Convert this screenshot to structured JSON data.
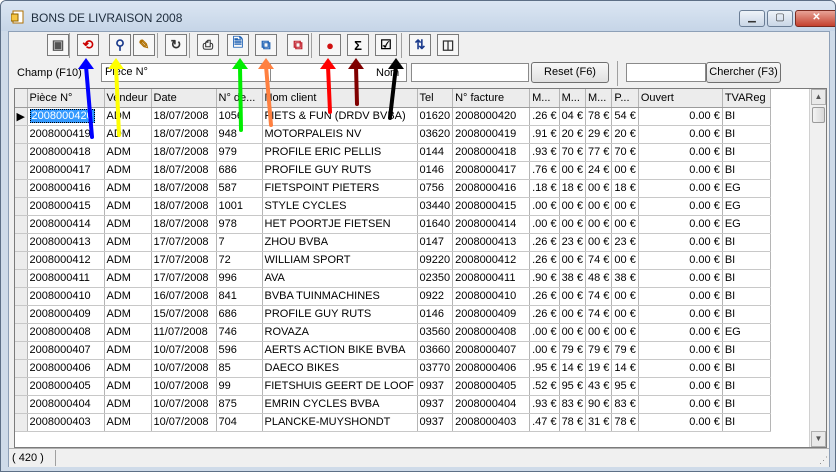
{
  "window": {
    "title": "BONS DE LIVRAISON 2008",
    "minimize_icon": "minimize-icon",
    "maximize_icon": "maximize-icon",
    "close_icon": "close-icon"
  },
  "toolbar": {
    "buttons": [
      {
        "name": "properties-button",
        "icon": "properties-icon",
        "glyph": "▣",
        "color": "#555555"
      },
      {
        "name": "stop-button",
        "icon": "stop-icon",
        "glyph": "⟲",
        "color": "#cc0000"
      },
      {
        "name": "find-button",
        "icon": "binoculars-icon",
        "glyph": "⚲",
        "color": "#1a3a8c"
      },
      {
        "name": "filter-button",
        "icon": "pencil-filter-icon",
        "glyph": "✎",
        "color": "#b07000"
      },
      {
        "name": "refresh-button",
        "icon": "refresh-icon",
        "glyph": "↻",
        "color": "#333333"
      },
      {
        "name": "print-button",
        "icon": "printer-icon",
        "glyph": "⎙",
        "color": "#333333"
      },
      {
        "name": "new-document-button",
        "icon": "document-edit-icon",
        "glyph": "🗎",
        "color": "#1a5fb4"
      },
      {
        "name": "copy-document-button",
        "icon": "documents-copy-icon",
        "glyph": "⧉",
        "color": "#1a5fb4"
      },
      {
        "name": "delete-document-button",
        "icon": "document-delete-icon",
        "glyph": "⧉",
        "color": "#c01c28"
      },
      {
        "name": "info-button",
        "icon": "info-icon",
        "glyph": "●",
        "color": "#d01010"
      },
      {
        "name": "sum-button",
        "icon": "sigma-icon",
        "glyph": "Σ",
        "color": "#000000"
      },
      {
        "name": "validate-button",
        "icon": "checkbox-icon",
        "glyph": "☑",
        "color": "#000000"
      },
      {
        "name": "sort-button",
        "icon": "sort-az-icon",
        "glyph": "⇅",
        "color": "#1a3a8c"
      },
      {
        "name": "columns-button",
        "icon": "columns-icon",
        "glyph": "◫",
        "color": "#333333"
      }
    ]
  },
  "search": {
    "field_label": "Champ (F10)",
    "field_value": "Pièce N°",
    "nom_label": "Nom",
    "nom_value": "",
    "reset_label": "Reset (F6)",
    "search_value": "",
    "search_label": "Chercher (F3)"
  },
  "table": {
    "columns": [
      "Pièce N°",
      "Vendeur",
      "Date",
      "N° de...",
      "Nom client",
      "Tel",
      "N° facture",
      "M...",
      "M...",
      "M...",
      "P...",
      "Ouvert",
      "TVAReg"
    ],
    "rows": [
      [
        "2008000420",
        "ADM",
        "18/07/2008",
        "1056",
        "FIETS & FUN (DRDV BVBA)",
        "01620",
        "2008000420",
        ".26 €",
        "04 €",
        "78 €",
        "54 €",
        "0.00 €",
        "BI"
      ],
      [
        "2008000419",
        "ADM",
        "18/07/2008",
        "948",
        "MOTORPALEIS NV",
        "03620",
        "2008000419",
        ".91 €",
        "20 €",
        "29 €",
        "20 €",
        "0.00 €",
        "BI"
      ],
      [
        "2008000418",
        "ADM",
        "18/07/2008",
        "979",
        "PROFILE ERIC PELLIS",
        "0144",
        "2008000418",
        ".93 €",
        "70 €",
        "77 €",
        "70 €",
        "0.00 €",
        "BI"
      ],
      [
        "2008000417",
        "ADM",
        "18/07/2008",
        "686",
        "PROFILE GUY RUTS",
        "0146",
        "2008000417",
        ".76 €",
        "00 €",
        "24 €",
        "00 €",
        "0.00 €",
        "BI"
      ],
      [
        "2008000416",
        "ADM",
        "18/07/2008",
        "587",
        "FIETSPOINT PIETERS",
        "0756",
        "2008000416",
        ".18 €",
        "18 €",
        "00 €",
        "18 €",
        "0.00 €",
        "EG"
      ],
      [
        "2008000415",
        "ADM",
        "18/07/2008",
        "1001",
        "STYLE CYCLES",
        "03440",
        "2008000415",
        ".00 €",
        "00 €",
        "00 €",
        "00 €",
        "0.00 €",
        "EG"
      ],
      [
        "2008000414",
        "ADM",
        "18/07/2008",
        "978",
        "HET POORTJE FIETSEN",
        "01640",
        "2008000414",
        ".00 €",
        "00 €",
        "00 €",
        "00 €",
        "0.00 €",
        "EG"
      ],
      [
        "2008000413",
        "ADM",
        "17/07/2008",
        "7",
        "ZHOU BVBA",
        "0147",
        "2008000413",
        ".26 €",
        "23 €",
        "00 €",
        "23 €",
        "0.00 €",
        "BI"
      ],
      [
        "2008000412",
        "ADM",
        "17/07/2008",
        "72",
        "WILLIAM SPORT",
        "09220",
        "2008000412",
        ".26 €",
        "00 €",
        "74 €",
        "00 €",
        "0.00 €",
        "BI"
      ],
      [
        "2008000411",
        "ADM",
        "17/07/2008",
        "996",
        "AVA",
        "02350",
        "2008000411",
        ".90 €",
        "38 €",
        "48 €",
        "38 €",
        "0.00 €",
        "BI"
      ],
      [
        "2008000410",
        "ADM",
        "16/07/2008",
        "841",
        "BVBA TUINMACHINES",
        "0922",
        "2008000410",
        ".26 €",
        "00 €",
        "74 €",
        "00 €",
        "0.00 €",
        "BI"
      ],
      [
        "2008000409",
        "ADM",
        "15/07/2008",
        "686",
        "PROFILE GUY RUTS",
        "0146",
        "2008000409",
        ".26 €",
        "00 €",
        "74 €",
        "00 €",
        "0.00 €",
        "BI"
      ],
      [
        "2008000408",
        "ADM",
        "11/07/2008",
        "746",
        "ROVAZA",
        "03560",
        "2008000408",
        ".00 €",
        "00 €",
        "00 €",
        "00 €",
        "0.00 €",
        "EG"
      ],
      [
        "2008000407",
        "ADM",
        "10/07/2008",
        "596",
        "AERTS ACTION BIKE BVBA",
        "03660",
        "2008000407",
        ".00 €",
        "79 €",
        "79 €",
        "79 €",
        "0.00 €",
        "BI"
      ],
      [
        "2008000406",
        "ADM",
        "10/07/2008",
        "85",
        "DAECO BIKES",
        "03770",
        "2008000406",
        ".95 €",
        "14 €",
        "19 €",
        "14 €",
        "0.00 €",
        "BI"
      ],
      [
        "2008000405",
        "ADM",
        "10/07/2008",
        "99",
        "FIETSHUIS GEERT DE LOOF",
        "0937",
        "2008000405",
        ".52 €",
        "95 €",
        "43 €",
        "95 €",
        "0.00 €",
        "BI"
      ],
      [
        "2008000404",
        "ADM",
        "10/07/2008",
        "875",
        "EMRIN CYCLES BVBA",
        "0937",
        "2008000404",
        ".93 €",
        "83 €",
        "90 €",
        "83 €",
        "0.00 €",
        "BI"
      ],
      [
        "2008000403",
        "ADM",
        "10/07/2008",
        "704",
        "PLANCKE-MUYSHONDT",
        "0937",
        "2008000403",
        ".47 €",
        "78 €",
        "31 €",
        "78 €",
        "0.00 €",
        "BI"
      ]
    ]
  },
  "status": {
    "count": "( 420 )"
  },
  "scroll": {
    "up_icon": "scroll-up-icon",
    "down_icon": "scroll-down-icon",
    "position": 0.0
  },
  "annotation_arrows": [
    {
      "color": "#0000ff"
    },
    {
      "color": "#ffff00"
    },
    {
      "color": "#00ee00"
    },
    {
      "color": "#ff8040"
    },
    {
      "color": "#ff0000"
    },
    {
      "color": "#800000"
    },
    {
      "color": "#000000"
    }
  ]
}
